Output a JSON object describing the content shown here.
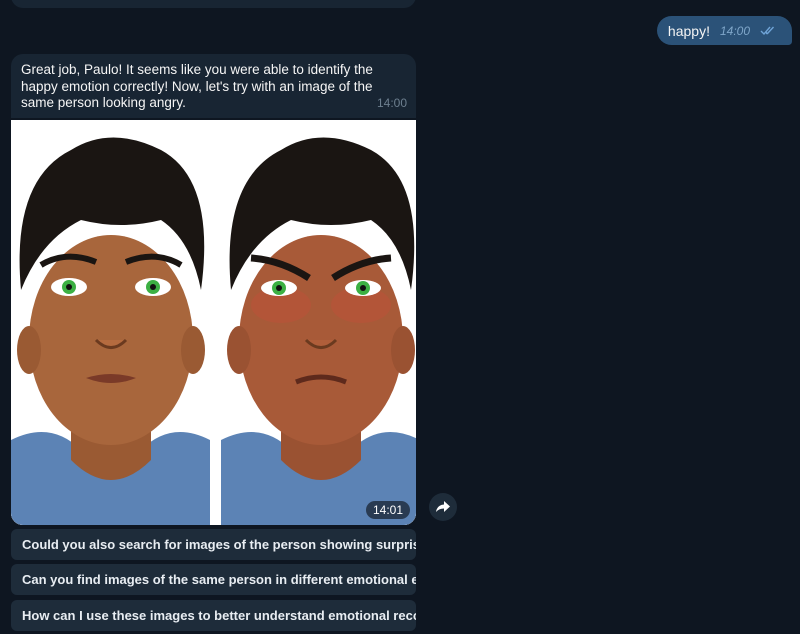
{
  "messages": {
    "outgoing": {
      "text": "happy!",
      "time": "14:00",
      "status_icon": "double-check-icon"
    },
    "incoming": {
      "text": "Great job, Paulo! It seems like you were able to identify the happy emotion correctly! Now, let's try with an image of the same person looking angry.",
      "time": "14:00"
    },
    "image": {
      "time": "14:01"
    }
  },
  "forward_icon": "forward-arrow-icon",
  "suggestions": [
    {
      "label": "Could you also search for images of the person showing surprise ..."
    },
    {
      "label": "Can you find images of the same person in different emotional e..."
    },
    {
      "label": "How can I use these images to better understand emotional reco..."
    }
  ],
  "colors": {
    "background": "#0e1621",
    "incoming_bubble": "#182533",
    "outgoing_bubble": "#2b5278",
    "suggestion_bg": "#1e2c3a"
  }
}
